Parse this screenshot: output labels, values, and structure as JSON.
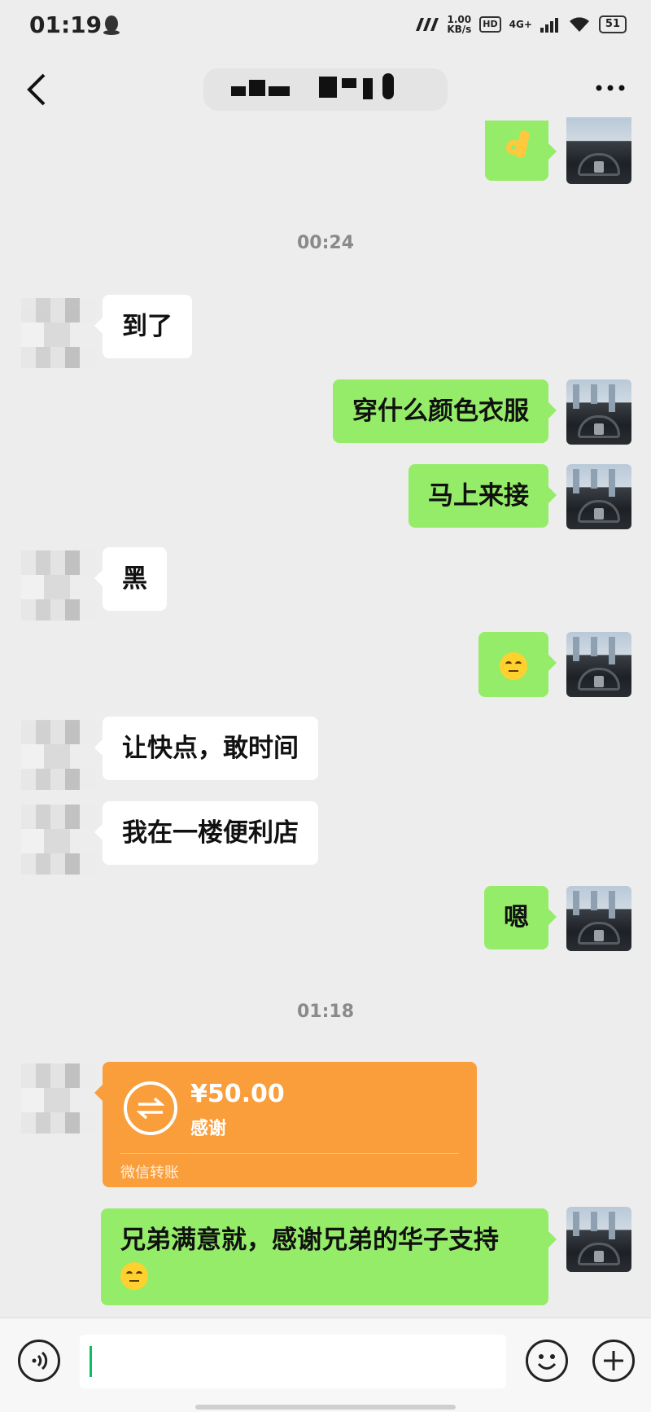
{
  "status_bar": {
    "time": "01:19",
    "net_speed_value": "1.00",
    "net_speed_unit": "KB/s",
    "hd": "HD",
    "network": "4G+",
    "battery": "51"
  },
  "header": {
    "back_icon": "chevron-left-icon",
    "more_icon": "more-dots-icon"
  },
  "messages": [
    {
      "side": "me",
      "type": "emoji",
      "emoji": "ok-hand-emoji"
    },
    {
      "type": "timestamp",
      "text": "00:24"
    },
    {
      "side": "other",
      "type": "text",
      "text": "到了"
    },
    {
      "side": "me",
      "type": "text",
      "text": "穿什么颜色衣服"
    },
    {
      "side": "me",
      "type": "text",
      "text": "马上来接"
    },
    {
      "side": "other",
      "type": "text",
      "text": "黑"
    },
    {
      "side": "me",
      "type": "emoji",
      "emoji": "smirk-face-emoji"
    },
    {
      "side": "other",
      "type": "text",
      "text": "让快点，敢时间"
    },
    {
      "side": "other",
      "type": "text",
      "text": "我在一楼便利店"
    },
    {
      "side": "me",
      "type": "text",
      "text": "嗯"
    },
    {
      "type": "timestamp",
      "text": "01:18"
    },
    {
      "side": "other",
      "type": "transfer",
      "amount": "¥50.00",
      "note": "感谢",
      "footer": "微信转账"
    },
    {
      "side": "me",
      "type": "text",
      "line1": "兄弟满意就，感谢兄弟的华子支持",
      "emoji": "smirk-face-emoji"
    }
  ],
  "input_bar": {
    "voice_icon": "voice-icon",
    "emoji_icon": "emoji-icon",
    "plus_icon": "plus-icon",
    "draft": ""
  },
  "colors": {
    "me_bubble": "#95ec69",
    "other_bubble": "#ffffff",
    "transfer_card": "#fa9d3b",
    "background": "#ededed",
    "caret": "#07c160"
  }
}
